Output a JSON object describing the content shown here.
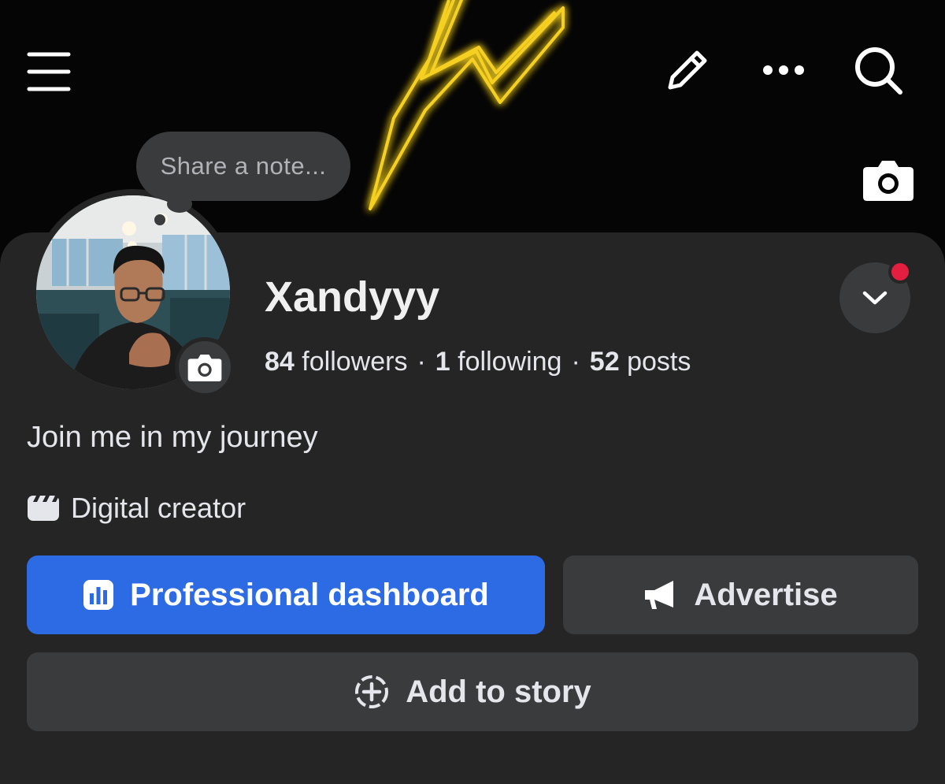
{
  "top_bar": {
    "menu_icon": "hamburger-menu-icon",
    "edit_icon": "pencil-icon",
    "more_icon": "more-dots-icon",
    "search_icon": "search-icon",
    "cover_camera_icon": "camera-icon"
  },
  "note": {
    "placeholder": "Share a note..."
  },
  "profile": {
    "name": "Xandyyy",
    "followers_count": "84",
    "followers_label": "followers",
    "following_count": "1",
    "following_label": "following",
    "posts_count": "52",
    "posts_label": "posts",
    "separator": "·",
    "bio": "Join me in my journey",
    "category": "Digital creator"
  },
  "actions": {
    "dashboard_label": "Professional dashboard",
    "advertise_label": "Advertise",
    "story_label": "Add to story"
  },
  "colors": {
    "primary_button": "#2d6be4",
    "secondary_button": "#3a3b3c",
    "sheet_background": "#252526",
    "notification_dot": "#e41e3f",
    "neon": "#f5d020"
  }
}
